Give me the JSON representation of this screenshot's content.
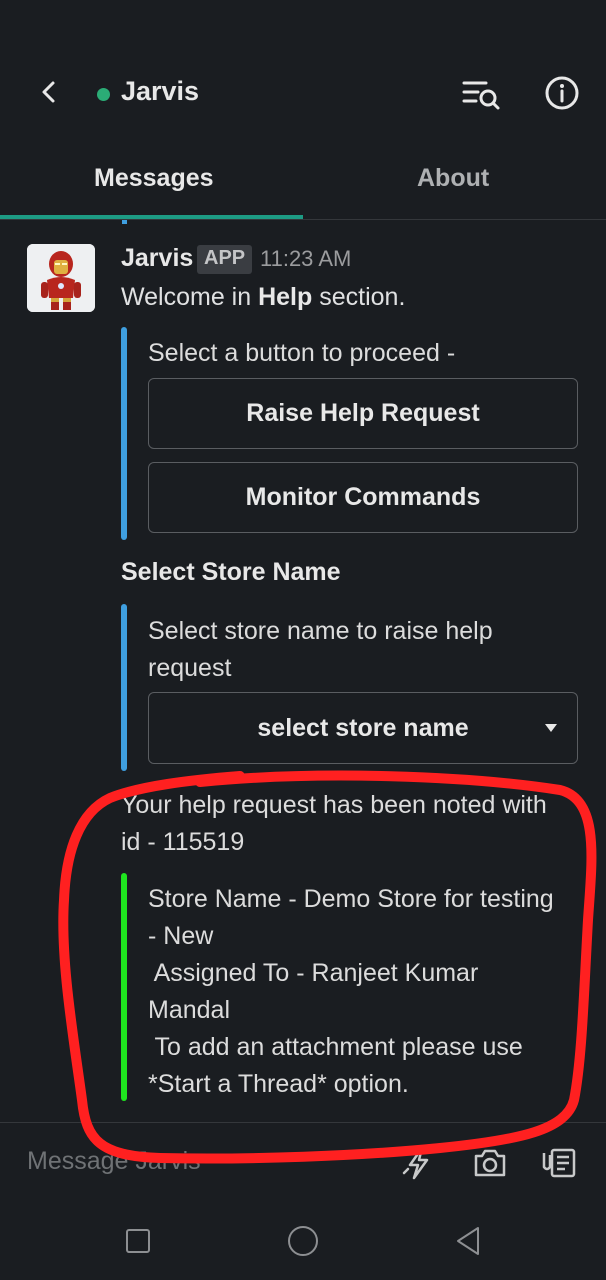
{
  "header": {
    "title": "Jarvis"
  },
  "tabs": [
    {
      "label": "Messages"
    },
    {
      "label": "About"
    }
  ],
  "message": {
    "sender": "Jarvis",
    "badge": "APP",
    "time": "11:23 AM",
    "welcome_prefix": "Welcome in ",
    "welcome_bold": "Help",
    "welcome_suffix": " section."
  },
  "action_block": {
    "prompt": "Select a button to proceed -",
    "buttons": [
      {
        "label": "Raise Help Request"
      },
      {
        "label": "Monitor Commands"
      }
    ]
  },
  "store_section": {
    "title": "Select Store Name",
    "prompt_line1": "Select store name to raise help",
    "prompt_line2": "request",
    "select_value": "select store name"
  },
  "result": {
    "line1": "Your help request has been noted with",
    "line2": "id - 115519",
    "details": [
      "Store Name - Demo Store for testing",
      "- New",
      " Assigned To - Ranjeet Kumar",
      "Mandal",
      " To add an attachment please use",
      "*Start a Thread* option."
    ]
  },
  "composer": {
    "placeholder": "Message Jarvis"
  },
  "colors": {
    "background": "#1a1d21",
    "accent_tab": "#1d9b84",
    "online_dot": "#2bac76",
    "attachment_bar_blue": "#3f9fe0",
    "attachment_bar_green": "#1fe51f",
    "annotation_red": "#ff2020"
  }
}
